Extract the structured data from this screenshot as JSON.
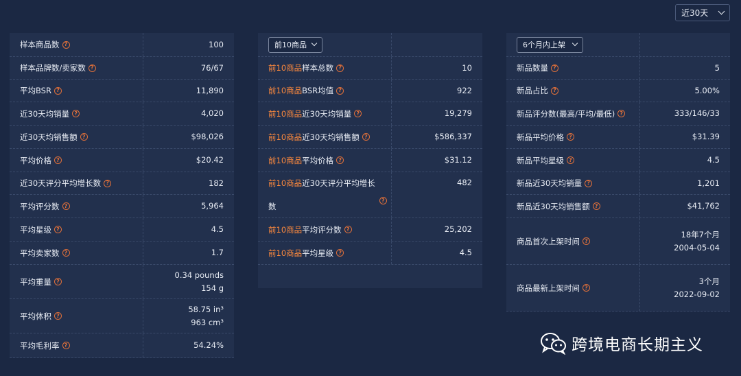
{
  "top_select": {
    "value": "近30天"
  },
  "panel1": {
    "rows": [
      {
        "label": "样本商品数",
        "value": "100"
      },
      {
        "label": "样本品牌数/卖家数",
        "value": "76/67"
      },
      {
        "label": "平均BSR",
        "value": "11,890"
      },
      {
        "label": "近30天均销量",
        "value": "4,020"
      },
      {
        "label": "近30天均销售额",
        "value": "$98,026"
      },
      {
        "label": "平均价格",
        "value": "$20.42"
      },
      {
        "label": "近30天评分平均增长数",
        "value": "182"
      },
      {
        "label": "平均评分数",
        "value": "5,964"
      },
      {
        "label": "平均星级",
        "value": "4.5"
      },
      {
        "label": "平均卖家数",
        "value": "1.7"
      },
      {
        "label": "平均重量",
        "value": "0.34 pounds",
        "value2": "154 g"
      },
      {
        "label": "平均体积",
        "value": "58.75 in³",
        "value2": "963 cm³"
      },
      {
        "label": "平均毛利率",
        "value": "54.24%"
      }
    ]
  },
  "panel2": {
    "select": "前10商品",
    "prefix": "前10商品",
    "rows": [
      {
        "label": "样本总数",
        "value": "10"
      },
      {
        "label": "BSR均值",
        "value": "922"
      },
      {
        "label": "近30天均销量",
        "value": "19,279"
      },
      {
        "label": "近30天均销售额",
        "value": "$586,337"
      },
      {
        "label": "平均价格",
        "value": "$31.12"
      },
      {
        "label": "近30天评分平均增长",
        "label2": "数",
        "value": "482"
      },
      {
        "label": "平均评分数",
        "value": "25,202"
      },
      {
        "label": "平均星级",
        "value": "4.5"
      }
    ]
  },
  "panel3": {
    "select": "6个月内上架",
    "rows": [
      {
        "label": "新品数量",
        "value": "5"
      },
      {
        "label": "新品占比",
        "value": "5.00%"
      },
      {
        "label": "新品评分数(最高/平均/最低)",
        "value": "333/146/33"
      },
      {
        "label": "新品平均价格",
        "value": "$31.39"
      },
      {
        "label": "新品平均星级",
        "value": "4.5"
      },
      {
        "label": "新品近30天均销量",
        "value": "1,201"
      },
      {
        "label": "新品近30天均销售额",
        "value": "$41,762"
      },
      {
        "label": "商品首次上架时间",
        "value": "18年7个月",
        "value2": "2004-05-04"
      },
      {
        "label": "商品最新上架时间",
        "value": "3个月",
        "value2": "2022-09-02"
      }
    ]
  },
  "watermark": {
    "text": "跨境电商长期主义"
  }
}
